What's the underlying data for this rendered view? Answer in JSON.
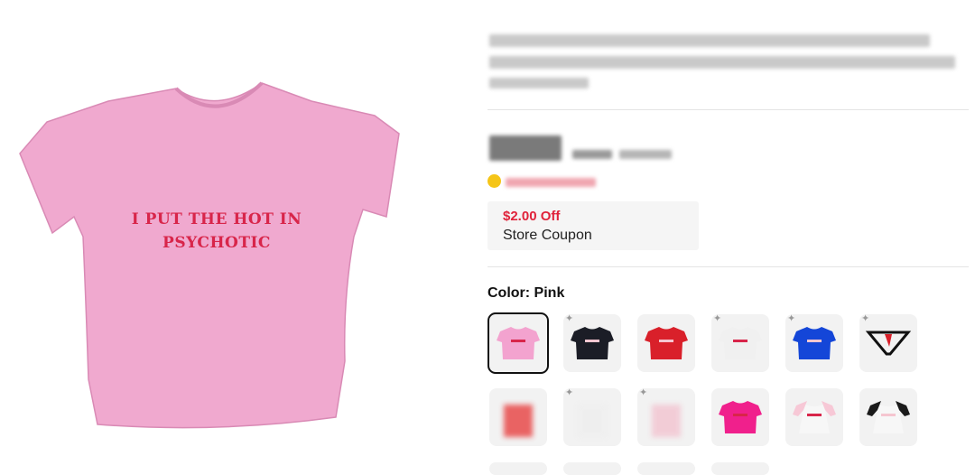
{
  "product": {
    "shirt_print_line1": "I PUT THE HOT IN",
    "shirt_print_line2": "PSYCHOTIC",
    "shirt_color": "#f0a9cf"
  },
  "coupon": {
    "amount": "$2.00 Off",
    "label": "Store Coupon",
    "amount_color": "#e0233b"
  },
  "color_selector": {
    "label": "Color: Pink",
    "swatches": [
      {
        "color": "#f3a3cf",
        "selected": true
      },
      {
        "color": "#1b1d26"
      },
      {
        "color": "#d9202a"
      },
      {
        "color": "#f0f0f0"
      },
      {
        "color": "#1446d8"
      },
      {
        "color": "#111111",
        "kind": "thong"
      },
      {
        "color": "#e84a4a",
        "kind": "blurred"
      },
      {
        "color": "#eeeeee",
        "kind": "blurred"
      },
      {
        "color": "#f2c6d2",
        "kind": "blurred"
      },
      {
        "color": "#f0208c"
      },
      {
        "color": "#f7c8d6",
        "kind": "raglan"
      },
      {
        "color": "#1a1a1a",
        "kind": "raglan"
      }
    ]
  }
}
